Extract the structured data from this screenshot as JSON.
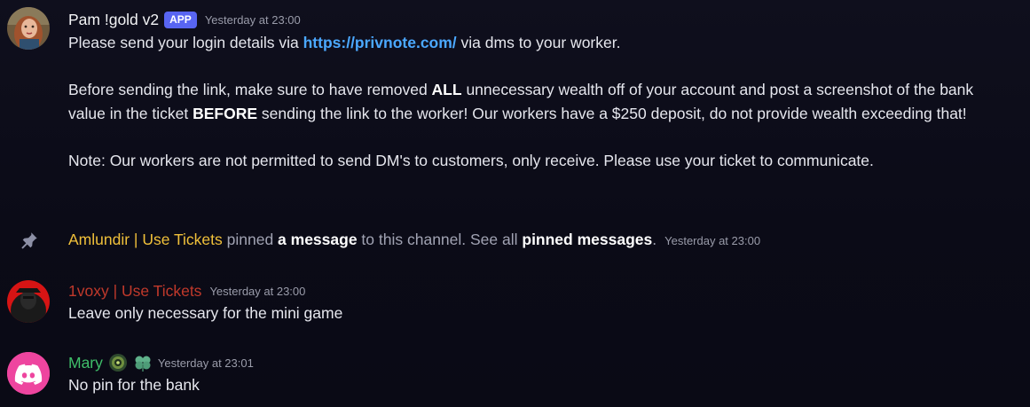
{
  "messages": [
    {
      "author": "Pam !gold v2",
      "badge": "APP",
      "timestamp": "Yesterday at 23:00",
      "author_color": "#f2f3f5",
      "line1_pre": "Please send your login details via ",
      "line1_link": "https://privnote.com/",
      "line1_post": " via dms to your worker.",
      "para2_a": "Before sending the link, make sure to have removed ",
      "para2_b": "ALL",
      "para2_c": " unnecessary wealth off of your account and post a screenshot of the bank value in the ticket ",
      "para2_d": "BEFORE",
      "para2_e": " sending the link to the worker! Our workers have a $250 deposit, do not provide wealth exceeding that!",
      "para3": "Note: Our workers are not permitted to send DM's to customers, only receive. Please use your ticket to communicate."
    },
    {
      "type": "system-pin",
      "icon": "pin-icon",
      "actor": "Amlundir | Use Tickets",
      "actor_color": "#f0c03a",
      "text_a": " pinned ",
      "link_a": "a message",
      "text_b": " to this channel. See all ",
      "link_b": "pinned messages",
      "text_c": ".",
      "timestamp": "Yesterday at 23:00"
    },
    {
      "author": "1voxy | Use Tickets",
      "author_color": "#c0392b",
      "timestamp": "Yesterday at 23:00",
      "text": "Leave only necessary for the mini game"
    },
    {
      "author": "Mary",
      "author_color": "#3fbf6a",
      "badges": [
        "eye-emoji-icon",
        "clover-emoji-icon"
      ],
      "timestamp": "Yesterday at 23:01",
      "text": "No pin for the bank",
      "avatar": "discord-logo-icon"
    }
  ],
  "colors": {
    "link": "#4ba8ff",
    "app_badge": "#5865f2",
    "discord_avatar": "#ee459f"
  }
}
